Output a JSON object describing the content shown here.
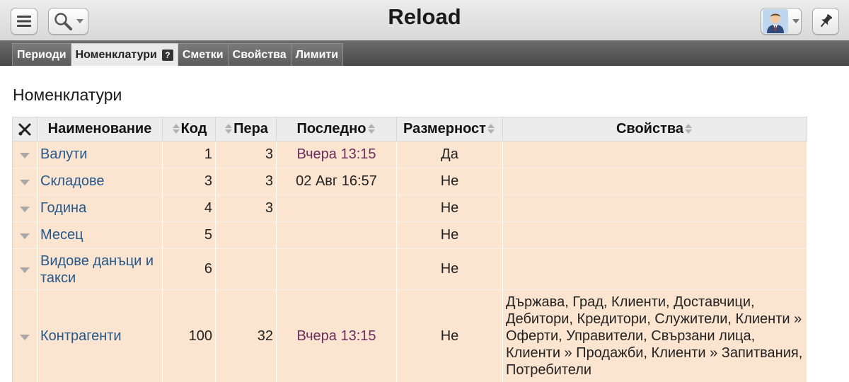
{
  "app": {
    "title": "Reload"
  },
  "toolbar": {
    "menu_icon": "hamburger-menu-icon",
    "search_icon": "magnifier-icon",
    "pin_icon": "pushpin-icon",
    "avatar_icon": "user-avatar"
  },
  "tabs": [
    {
      "label": "Периоди",
      "active": false
    },
    {
      "label": "Номенклатури",
      "active": true,
      "help": "?"
    },
    {
      "label": "Сметки",
      "active": false
    },
    {
      "label": "Свойства",
      "active": false
    },
    {
      "label": "Лимити",
      "active": false
    }
  ],
  "page": {
    "heading": "Номенклатури"
  },
  "table": {
    "tools_icon": "tools-icon",
    "headers": {
      "name": "Наименование",
      "code": "Код",
      "entries": "Пера",
      "last": "Последно",
      "dimension": "Размерност",
      "properties": "Свойства"
    },
    "rows": [
      {
        "name": "Валути",
        "code": "1",
        "entries": "3",
        "last": "Вчера 13:15",
        "dimension": "Да",
        "properties": ""
      },
      {
        "name": "Складове",
        "code": "3",
        "entries": "3",
        "last": "02 Авг 16:57",
        "dimension": "Не",
        "properties": ""
      },
      {
        "name": "Година",
        "code": "4",
        "entries": "3",
        "last": "",
        "dimension": "Не",
        "properties": ""
      },
      {
        "name": "Месец",
        "code": "5",
        "entries": "",
        "last": "",
        "dimension": "Не",
        "properties": ""
      },
      {
        "name": "Видове данъци и такси",
        "code": "6",
        "entries": "",
        "last": "",
        "dimension": "Не",
        "properties": ""
      },
      {
        "name": "Контрагенти",
        "code": "100",
        "entries": "32",
        "last": "Вчера 13:15",
        "dimension": "Не",
        "properties": "Държава, Град, Клиенти, Доставчици, Дебитори, Кредитори, Служители, Клиенти » Оферти, Управители, Свързани лица, Клиенти » Продажби, Клиенти » Запитвания, Потребители"
      }
    ]
  },
  "colors": {
    "row_bg": "#fbe5d0",
    "link": "#24578a",
    "date": "#6b2c5e",
    "tab_bar": "#5a5a5a"
  }
}
